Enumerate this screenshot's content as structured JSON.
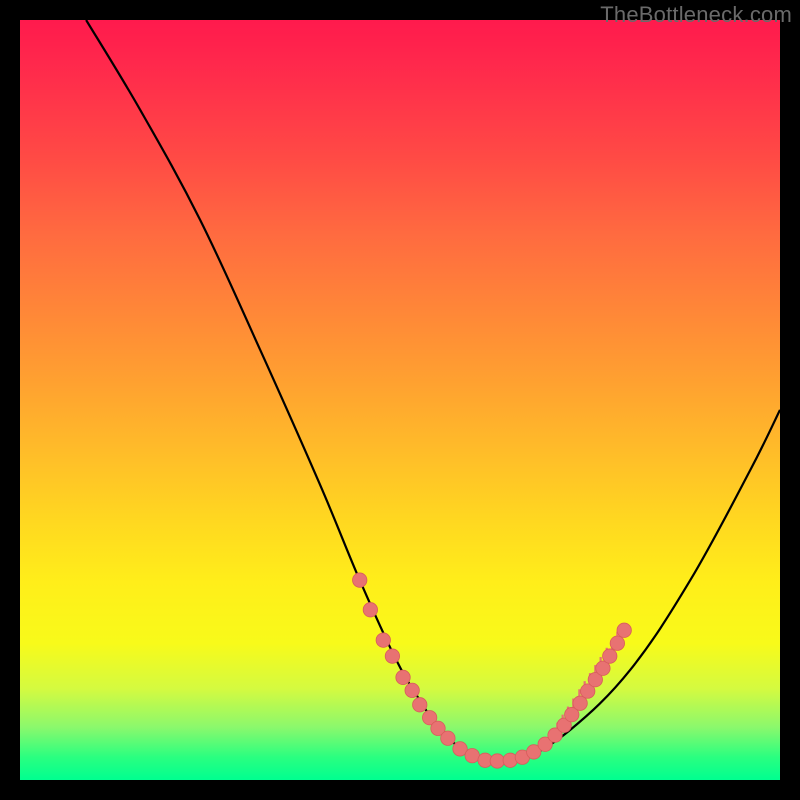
{
  "watermark": "TheBottleneck.com",
  "colors": {
    "frame": "#000000",
    "curve": "#000000",
    "marker_fill": "#e87272",
    "marker_stroke": "#d85c5c"
  },
  "chart_data": {
    "type": "line",
    "title": "",
    "xlabel": "",
    "ylabel": "",
    "xlim": [
      0,
      100
    ],
    "ylim": [
      0,
      100
    ],
    "annotations": [],
    "grid": false,
    "legend": false,
    "series": [
      {
        "name": "curve",
        "x": [
          8.7,
          15.8,
          23.7,
          31.6,
          39.5,
          44.7,
          49.5,
          52.6,
          55.3,
          58.4,
          61.6,
          65.8,
          72.4,
          80.3,
          88.2,
          96.1,
          100
        ],
        "y": [
          100,
          88.2,
          73.7,
          56.6,
          38.8,
          26.3,
          15.8,
          10.5,
          6.6,
          3.9,
          2.6,
          2.6,
          6.6,
          14.5,
          26.3,
          40.8,
          48.7
        ]
      }
    ],
    "markers_left": [
      {
        "x": 44.7,
        "y": 26.3
      },
      {
        "x": 46.1,
        "y": 22.4
      },
      {
        "x": 47.8,
        "y": 18.4
      },
      {
        "x": 49.0,
        "y": 16.3
      },
      {
        "x": 50.4,
        "y": 13.5
      },
      {
        "x": 51.6,
        "y": 11.8
      },
      {
        "x": 52.6,
        "y": 9.9
      },
      {
        "x": 53.9,
        "y": 8.2
      },
      {
        "x": 55.0,
        "y": 6.8
      },
      {
        "x": 56.3,
        "y": 5.5
      }
    ],
    "markers_bottom": [
      {
        "x": 57.9,
        "y": 4.1
      },
      {
        "x": 59.5,
        "y": 3.2
      },
      {
        "x": 61.2,
        "y": 2.6
      },
      {
        "x": 62.8,
        "y": 2.5
      },
      {
        "x": 64.5,
        "y": 2.6
      },
      {
        "x": 66.1,
        "y": 3.0
      },
      {
        "x": 67.6,
        "y": 3.7
      },
      {
        "x": 69.1,
        "y": 4.7
      }
    ],
    "markers_right": [
      {
        "x": 70.4,
        "y": 5.9
      },
      {
        "x": 71.6,
        "y": 7.2
      },
      {
        "x": 72.6,
        "y": 8.6
      },
      {
        "x": 73.7,
        "y": 10.1
      },
      {
        "x": 74.7,
        "y": 11.7
      },
      {
        "x": 75.7,
        "y": 13.2
      },
      {
        "x": 76.7,
        "y": 14.7
      },
      {
        "x": 77.6,
        "y": 16.3
      },
      {
        "x": 78.6,
        "y": 18.0
      },
      {
        "x": 79.5,
        "y": 19.7
      }
    ],
    "tick_clusters_right_x": [
      70.7,
      71.4,
      72.1,
      72.8,
      73.6,
      74.3,
      75.0,
      75.7,
      76.4,
      77.2,
      77.9,
      78.6,
      79.3
    ]
  }
}
